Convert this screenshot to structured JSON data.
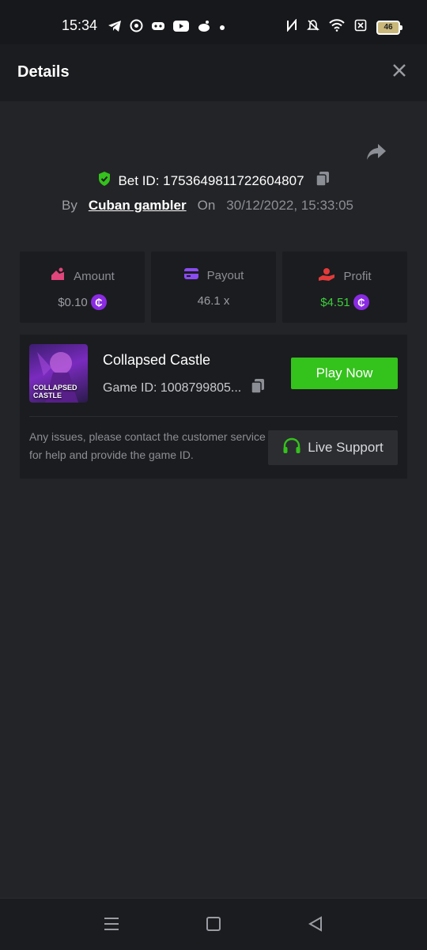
{
  "status_bar": {
    "time": "15:34",
    "battery": "46",
    "left_icons": [
      "telegram-icon",
      "whatsapp-icon",
      "discord-icon",
      "youtube-icon",
      "reddit-icon",
      "dot-icon"
    ],
    "right_icons": [
      "nfc-icon",
      "bell-off-icon",
      "wifi-icon",
      "sim-off-icon",
      "battery-icon"
    ]
  },
  "header": {
    "title": "Details"
  },
  "bet": {
    "id_label": "Bet ID: 1753649811722604807",
    "by_label": "By",
    "user": "Cuban gambler",
    "on_label": "On",
    "date": "30/12/2022, 15:33:05"
  },
  "stats": {
    "amount": {
      "label": "Amount",
      "value": "$0.10"
    },
    "payout": {
      "label": "Payout",
      "value": "46.1 x"
    },
    "profit": {
      "label": "Profit",
      "value": "$4.51"
    }
  },
  "game": {
    "thumb_text": "COLLAPSED CASTLE",
    "name": "Collapsed Castle",
    "id": "Game ID: 1008799805...",
    "play_label": "Play Now",
    "issue_text": "Any issues, please contact the customer service for help and provide the game ID.",
    "support_label": "Live Support"
  },
  "colors": {
    "accent_green": "#34c21c",
    "coin_purple": "#8a2be2",
    "profit_green": "#3ccf3c",
    "amount_pink": "#e0457b",
    "payout_purple": "#8a4cf0",
    "profit_red": "#e23b3b"
  }
}
